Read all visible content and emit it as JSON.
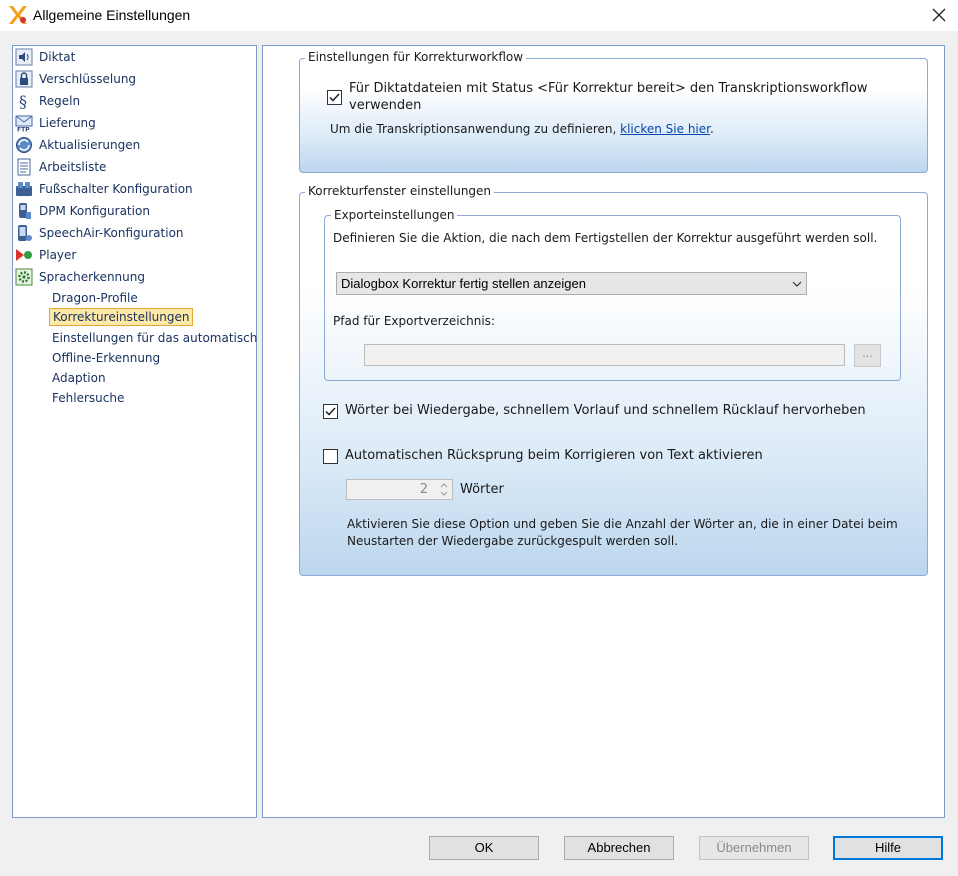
{
  "window": {
    "title": "Allgemeine Einstellungen"
  },
  "tree": {
    "items": [
      {
        "label": "Diktat",
        "icon": "speaker-icon"
      },
      {
        "label": "Verschlüsselung",
        "icon": "lock-icon"
      },
      {
        "label": "Regeln",
        "icon": "paragraph-icon"
      },
      {
        "label": "Lieferung",
        "icon": "ftp-mail-icon"
      },
      {
        "label": "Aktualisierungen",
        "icon": "refresh-globe-icon"
      },
      {
        "label": "Arbeitsliste",
        "icon": "document-list-icon"
      },
      {
        "label": "Fußschalter Konfiguration",
        "icon": "footswitch-icon"
      },
      {
        "label": "DPM Konfiguration",
        "icon": "dpm-recorder-icon"
      },
      {
        "label": "SpeechAir-Konfiguration",
        "icon": "speechair-device-icon"
      },
      {
        "label": "Player",
        "icon": "player-icon"
      },
      {
        "label": "Spracherkennung",
        "icon": "gear-icon"
      }
    ],
    "subitems": [
      "Dragon-Profile",
      "Korrektureinstellungen",
      "Einstellungen für das automatisch",
      "Offline-Erkennung",
      "Adaption",
      "Fehlersuche"
    ]
  },
  "workflow_group": {
    "legend": "Einstellungen für Korrekturworkflow",
    "checkbox_label_line1": "Für Diktatdateien mit Status <Für Korrektur bereit> den Transkriptionsworkflow",
    "checkbox_label_line2": "verwenden",
    "checkbox_checked": true,
    "info_text": "Um die Transkriptionsanwendung zu definieren,",
    "link_text": "klicken Sie hier",
    "link_suffix": "."
  },
  "korrektur_group": {
    "legend": "Korrekturfenster einstellungen",
    "export": {
      "legend": "Exporteinstellungen",
      "description": "Definieren Sie die Aktion, die nach dem Fertigstellen der Korrektur ausgeführt werden soll.",
      "selected_action": "Dialogbox Korrektur fertig stellen anzeigen",
      "path_label": "Pfad für Exportverzeichnis:",
      "path_value": "",
      "browse_label": "..."
    },
    "highlight_checkbox": {
      "label": "Wörter bei Wiedergabe, schnellem Vorlauf und schnellem Rücklauf hervorheben",
      "checked": true
    },
    "autoreturn_checkbox": {
      "label": "Automatischen Rücksprung beim Korrigieren von Text aktivieren",
      "checked": false
    },
    "words_value": "2",
    "words_unit": "Wörter",
    "help_line1": "Aktivieren Sie diese Option und geben Sie die Anzahl der Wörter an, die in einer Datei beim",
    "help_line2": "Neustarten der Wiedergabe zurückgespult werden soll."
  },
  "buttons": {
    "ok": "OK",
    "cancel": "Abbrechen",
    "apply": "Übernehmen",
    "help": "Hilfe"
  }
}
